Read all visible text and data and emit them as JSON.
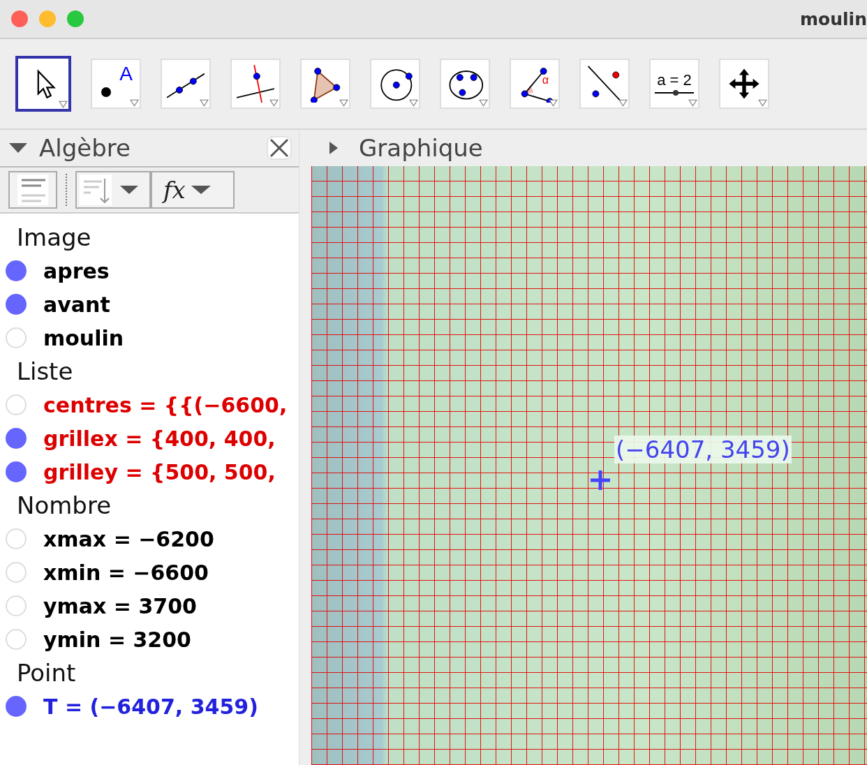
{
  "window": {
    "title": "moulin"
  },
  "tools": [
    {
      "kind": "move",
      "selected": true
    },
    {
      "kind": "point",
      "selected": false,
      "glyph": "A"
    },
    {
      "kind": "line",
      "selected": false
    },
    {
      "kind": "perpendicular",
      "selected": false
    },
    {
      "kind": "polygon",
      "selected": false
    },
    {
      "kind": "circle",
      "selected": false
    },
    {
      "kind": "conic",
      "selected": false
    },
    {
      "kind": "angle",
      "selected": false,
      "glyph": "α"
    },
    {
      "kind": "reflect",
      "selected": false
    },
    {
      "kind": "slider",
      "selected": false,
      "glyph": "a = 2"
    },
    {
      "kind": "pan",
      "selected": false
    }
  ],
  "algebra": {
    "title": "Algèbre",
    "expanded": true,
    "fx_label": "fx",
    "groups": [
      {
        "heading": "Image",
        "items": [
          {
            "text": "apres",
            "visible": true,
            "color": "#000000"
          },
          {
            "text": "avant",
            "visible": true,
            "color": "#000000"
          },
          {
            "text": "moulin",
            "visible": false,
            "color": "#000000"
          }
        ]
      },
      {
        "heading": "Liste",
        "items": [
          {
            "text": "centres = {{(−6600,",
            "visible": false,
            "color": "#dd0000"
          },
          {
            "text": "grillex = {400, 400,",
            "visible": true,
            "color": "#dd0000"
          },
          {
            "text": "grilley = {500, 500,",
            "visible": true,
            "color": "#dd0000"
          }
        ]
      },
      {
        "heading": "Nombre",
        "items": [
          {
            "text": "xmax = −6200",
            "visible": false,
            "color": "#000000"
          },
          {
            "text": "xmin = −6600",
            "visible": false,
            "color": "#000000"
          },
          {
            "text": "ymax = 3700",
            "visible": false,
            "color": "#000000"
          },
          {
            "text": "ymin = 3200",
            "visible": false,
            "color": "#000000"
          }
        ]
      },
      {
        "heading": "Point",
        "items": [
          {
            "text": "T = (−6407, 3459)",
            "visible": true,
            "color": "#2222dd"
          }
        ]
      }
    ]
  },
  "graphics": {
    "title": "Graphique",
    "expanded": false,
    "point_label": "(−6407, 3459)"
  }
}
